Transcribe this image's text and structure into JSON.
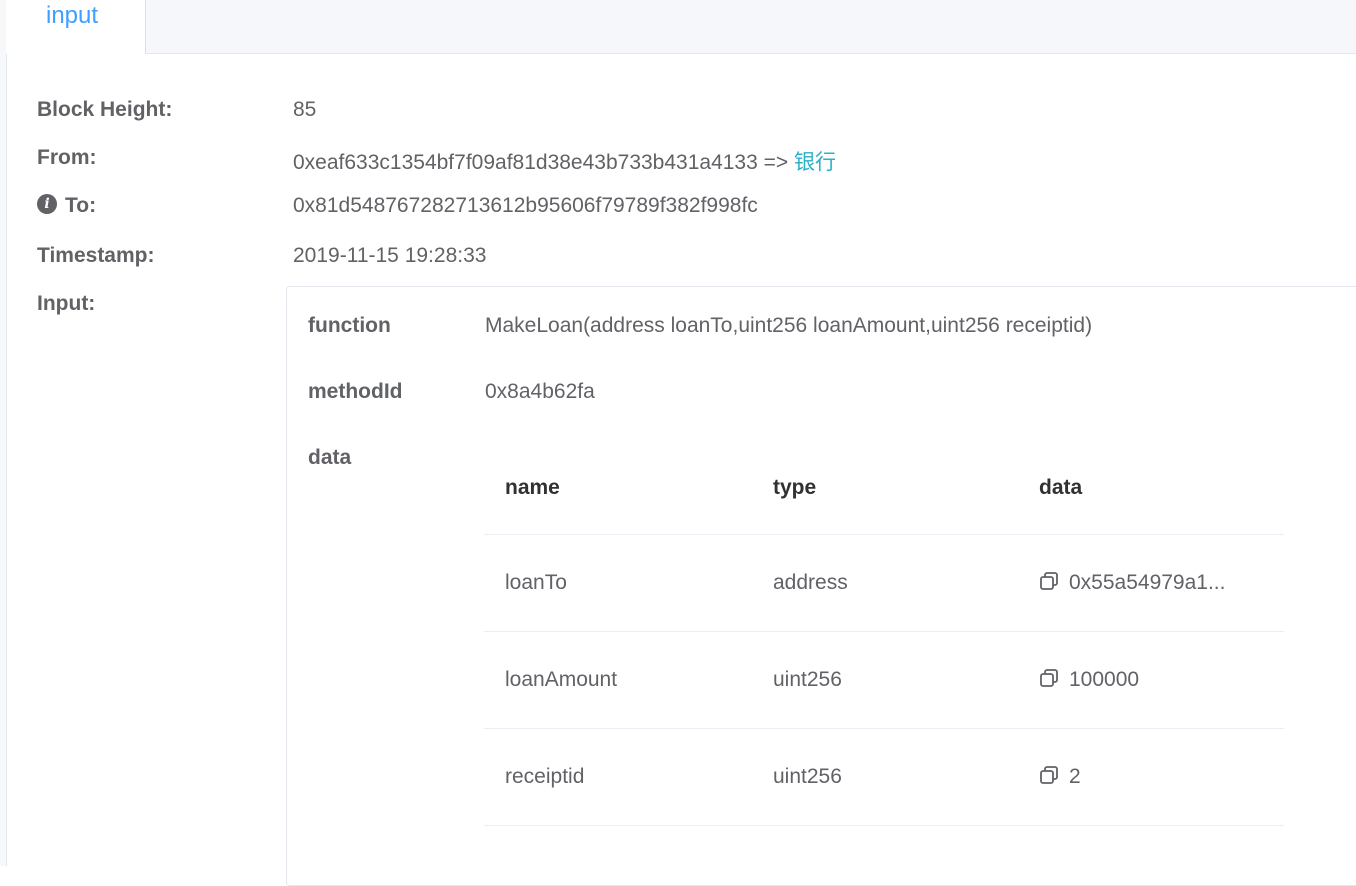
{
  "tabs": [
    {
      "label": "input"
    }
  ],
  "details": {
    "block_height": {
      "label": "Block Height:",
      "value": "85"
    },
    "from": {
      "label": "From:",
      "address": "0xeaf633c1354bf7f09af81d38e43b733b431a4133",
      "arrow": "=>",
      "name": "银行"
    },
    "to": {
      "label": "To:",
      "value": "0x81d548767282713612b95606f79789f382f998fc",
      "icon": "info-circle-icon"
    },
    "timestamp": {
      "label": "Timestamp:",
      "value": "2019-11-15 19:28:33"
    },
    "input": {
      "label": "Input:"
    }
  },
  "input_panel": {
    "function": {
      "label": "function",
      "value": "MakeLoan(address loanTo,uint256 loanAmount,uint256 receiptid)"
    },
    "method_id": {
      "label": "methodId",
      "value": "0x8a4b62fa"
    },
    "data": {
      "label": "data",
      "columns": [
        "name",
        "type",
        "data"
      ],
      "rows": [
        {
          "name": "loanTo",
          "type": "address",
          "data": "0x55a54979a1..."
        },
        {
          "name": "loanAmount",
          "type": "uint256",
          "data": "100000"
        },
        {
          "name": "receiptid",
          "type": "uint256",
          "data": "2"
        }
      ],
      "copy_icon": "copy-icon"
    }
  },
  "colors": {
    "tab_active": "#409eff",
    "link": "#2ab0c8",
    "text": "#606266",
    "header_text": "#303133",
    "border": "#e4e7ed"
  }
}
